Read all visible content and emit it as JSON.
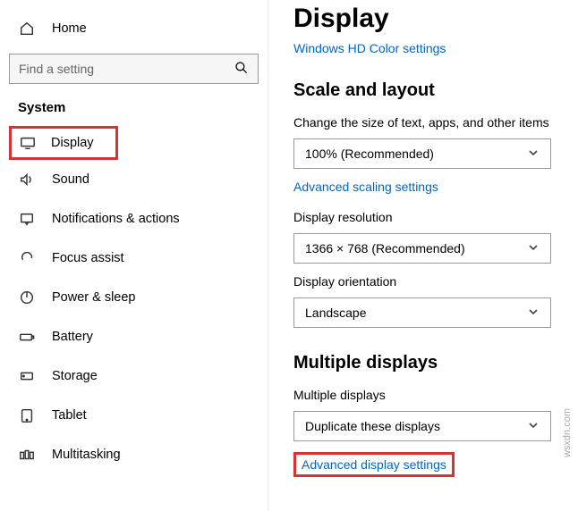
{
  "sidebar": {
    "home": "Home",
    "search_placeholder": "Find a setting",
    "section": "System",
    "items": [
      {
        "label": "Display",
        "icon": "display-icon",
        "active": true
      },
      {
        "label": "Sound",
        "icon": "sound-icon"
      },
      {
        "label": "Notifications & actions",
        "icon": "notifications-icon"
      },
      {
        "label": "Focus assist",
        "icon": "focus-assist-icon"
      },
      {
        "label": "Power & sleep",
        "icon": "power-icon"
      },
      {
        "label": "Battery",
        "icon": "battery-icon"
      },
      {
        "label": "Storage",
        "icon": "storage-icon"
      },
      {
        "label": "Tablet",
        "icon": "tablet-icon"
      },
      {
        "label": "Multitasking",
        "icon": "multitasking-icon"
      }
    ]
  },
  "main": {
    "title": "Display",
    "hd_link": "Windows HD Color settings",
    "scale_heading": "Scale and layout",
    "scale_label": "Change the size of text, apps, and other items",
    "scale_value": "100% (Recommended)",
    "adv_scaling_link": "Advanced scaling settings",
    "resolution_label": "Display resolution",
    "resolution_value": "1366 × 768 (Recommended)",
    "orientation_label": "Display orientation",
    "orientation_value": "Landscape",
    "multiple_heading": "Multiple displays",
    "multiple_label": "Multiple displays",
    "multiple_value": "Duplicate these displays",
    "adv_display_link": "Advanced display settings"
  },
  "watermark": "wsxdn.com"
}
